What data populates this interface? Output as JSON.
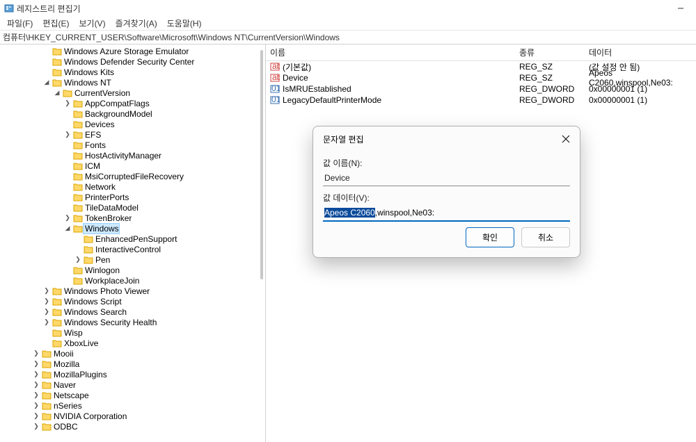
{
  "window": {
    "title": "레지스트리 편집기"
  },
  "menu": {
    "file": "파일(F)",
    "edit": "편집(E)",
    "view": "보기(V)",
    "fav": "즐겨찾기(A)",
    "help": "도움말(H)"
  },
  "address": "컴퓨터\\HKEY_CURRENT_USER\\Software\\Microsoft\\Windows NT\\CurrentVersion\\Windows",
  "tree": {
    "items": [
      {
        "d": 4,
        "c": "",
        "l": "Windows Azure Storage Emulator"
      },
      {
        "d": 4,
        "c": "",
        "l": "Windows Defender Security Center"
      },
      {
        "d": 4,
        "c": "",
        "l": "Windows Kits"
      },
      {
        "d": 4,
        "c": "v",
        "l": "Windows NT"
      },
      {
        "d": 5,
        "c": "v",
        "l": "CurrentVersion"
      },
      {
        "d": 6,
        "c": ">",
        "l": "AppCompatFlags"
      },
      {
        "d": 6,
        "c": "",
        "l": "BackgroundModel"
      },
      {
        "d": 6,
        "c": "",
        "l": "Devices"
      },
      {
        "d": 6,
        "c": ">",
        "l": "EFS"
      },
      {
        "d": 6,
        "c": "",
        "l": "Fonts"
      },
      {
        "d": 6,
        "c": "",
        "l": "HostActivityManager"
      },
      {
        "d": 6,
        "c": "",
        "l": "ICM"
      },
      {
        "d": 6,
        "c": "",
        "l": "MsiCorruptedFileRecovery"
      },
      {
        "d": 6,
        "c": "",
        "l": "Network"
      },
      {
        "d": 6,
        "c": "",
        "l": "PrinterPorts"
      },
      {
        "d": 6,
        "c": "",
        "l": "TileDataModel"
      },
      {
        "d": 6,
        "c": ">",
        "l": "TokenBroker"
      },
      {
        "d": 6,
        "c": "v",
        "l": "Windows",
        "sel": true
      },
      {
        "d": 7,
        "c": "",
        "l": "EnhancedPenSupport"
      },
      {
        "d": 7,
        "c": "",
        "l": "InteractiveControl"
      },
      {
        "d": 7,
        "c": ">",
        "l": "Pen"
      },
      {
        "d": 6,
        "c": "",
        "l": "Winlogon"
      },
      {
        "d": 6,
        "c": "",
        "l": "WorkplaceJoin"
      },
      {
        "d": 4,
        "c": ">",
        "l": "Windows Photo Viewer"
      },
      {
        "d": 4,
        "c": ">",
        "l": "Windows Script"
      },
      {
        "d": 4,
        "c": ">",
        "l": "Windows Search"
      },
      {
        "d": 4,
        "c": ">",
        "l": "Windows Security Health"
      },
      {
        "d": 4,
        "c": "",
        "l": "Wisp"
      },
      {
        "d": 4,
        "c": "",
        "l": "XboxLive"
      },
      {
        "d": 3,
        "c": ">",
        "l": "Mooii"
      },
      {
        "d": 3,
        "c": ">",
        "l": "Mozilla"
      },
      {
        "d": 3,
        "c": ">",
        "l": "MozillaPlugins"
      },
      {
        "d": 3,
        "c": ">",
        "l": "Naver"
      },
      {
        "d": 3,
        "c": ">",
        "l": "Netscape"
      },
      {
        "d": 3,
        "c": ">",
        "l": "nSeries"
      },
      {
        "d": 3,
        "c": ">",
        "l": "NVIDIA Corporation"
      },
      {
        "d": 3,
        "c": ">",
        "l": "ODBC"
      }
    ]
  },
  "list": {
    "cols": {
      "name": "이름",
      "type": "종류",
      "data": "데이터"
    },
    "rows": [
      {
        "icon": "str",
        "name": "(기본값)",
        "type": "REG_SZ",
        "data": "(값 설정 안 됨)"
      },
      {
        "icon": "str",
        "name": "Device",
        "type": "REG_SZ",
        "data": "Apeos C2060,winspool,Ne03:"
      },
      {
        "icon": "bin",
        "name": "IsMRUEstablished",
        "type": "REG_DWORD",
        "data": "0x00000001 (1)"
      },
      {
        "icon": "bin",
        "name": "LegacyDefaultPrinterMode",
        "type": "REG_DWORD",
        "data": "0x00000001 (1)"
      }
    ]
  },
  "dialog": {
    "title": "문자열 편집",
    "name_label": "값 이름(N):",
    "name_value": "Device",
    "data_label": "값 데이터(V):",
    "data_selected": "Apeos C2060",
    "data_rest": ",winspool,Ne03:",
    "ok": "확인",
    "cancel": "취소"
  }
}
